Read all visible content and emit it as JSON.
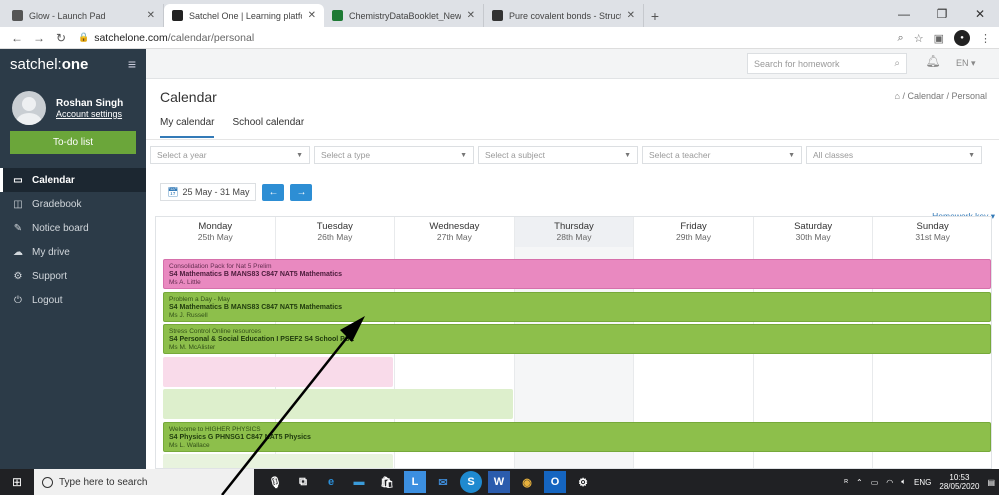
{
  "browser": {
    "tabs": [
      {
        "label": "Glow - Launch Pad",
        "color": "#555555",
        "active": false
      },
      {
        "label": "Satchel One | Learning platform",
        "color": "#222222",
        "active": true
      },
      {
        "label": "ChemistryDataBooklet_NewH_Al",
        "color": "#1e7a34",
        "active": false
      },
      {
        "label": "Pure covalent bonds - Structure",
        "color": "#333333",
        "active": false
      }
    ],
    "new_tab": "+",
    "url_host": "satchelone.com",
    "url_path": "/calendar/personal"
  },
  "app": {
    "brand_prefix": "satchel:",
    "brand_suffix": "one",
    "search_placeholder": "Search for homework",
    "lang": "EN"
  },
  "user": {
    "name": "Roshan Singh",
    "settings": "Account settings"
  },
  "todo_label": "To-do list",
  "menu": [
    {
      "label": "Calendar",
      "icon": "calendar-icon",
      "glyph": "▭",
      "active": true
    },
    {
      "label": "Gradebook",
      "icon": "gradebook-icon",
      "glyph": "◫",
      "active": false
    },
    {
      "label": "Notice board",
      "icon": "pin-icon",
      "glyph": "✎",
      "active": false
    },
    {
      "label": "My drive",
      "icon": "cloud-icon",
      "glyph": "☁",
      "active": false
    },
    {
      "label": "Support",
      "icon": "gear-icon",
      "glyph": "⚙",
      "active": false
    },
    {
      "label": "Logout",
      "icon": "power-icon",
      "glyph": "⏻",
      "active": false
    }
  ],
  "page": {
    "title": "Calendar",
    "breadcrumb": "Calendar / Personal",
    "tabs": [
      "My calendar",
      "School calendar"
    ]
  },
  "filters": [
    {
      "placeholder": "Select a year",
      "width": 160
    },
    {
      "placeholder": "Select a type",
      "width": 160
    },
    {
      "placeholder": "Select a subject",
      "width": 160
    },
    {
      "placeholder": "Select a teacher",
      "width": 160
    },
    {
      "placeholder": "All classes",
      "width": 176
    }
  ],
  "date_range": "25 May - 31 May",
  "homework_key": "Homework key",
  "days": [
    {
      "name": "Monday",
      "date": "25th May",
      "today": false
    },
    {
      "name": "Tuesday",
      "date": "26th May",
      "today": false
    },
    {
      "name": "Wednesday",
      "date": "27th May",
      "today": false
    },
    {
      "name": "Thursday",
      "date": "28th May",
      "today": true
    },
    {
      "name": "Friday",
      "date": "29th May",
      "today": false
    },
    {
      "name": "Saturday",
      "date": "30th May",
      "today": false
    },
    {
      "name": "Sunday",
      "date": "31st May",
      "today": false
    }
  ],
  "events": [
    {
      "title": "Consolidation Pack for Nat 5 Prelim",
      "class": "S4 Mathematics B MANS83 C847 NAT5 Mathematics",
      "teacher": "Ms A. Little",
      "style": "pink",
      "start": 0,
      "span": 7,
      "row": 0
    },
    {
      "title": "Problem a Day - May",
      "class": "S4 Mathematics B MANS83 C847 NAT5 Mathematics",
      "teacher": "Ms J. Russell",
      "style": "green",
      "start": 0,
      "span": 7,
      "row": 1
    },
    {
      "title": "Stress Control Online resources",
      "class": "S4 Personal & Social Education I PSEF2 S4 School PSE",
      "teacher": "Ms M. McAlister",
      "style": "green",
      "start": 0,
      "span": 7,
      "row": 2
    },
    {
      "title": "",
      "class": "",
      "teacher": "",
      "style": "faint-pink",
      "start": 0,
      "span": 2,
      "row": 3
    },
    {
      "title": "",
      "class": "",
      "teacher": "",
      "style": "faint-green",
      "start": 0,
      "span": 3,
      "row": 4
    },
    {
      "title": "Welcome to HIGHER PHYSICS",
      "class": "S4 Physics G PHNSG1 C847 NAT5 Physics",
      "teacher": "Ms L. Wallace",
      "style": "green",
      "start": 0,
      "span": 7,
      "row": 5
    },
    {
      "title": "",
      "class": "",
      "teacher": "",
      "style": "faint-green2",
      "start": 0,
      "span": 2,
      "row": 6
    }
  ],
  "taskbar": {
    "search": "Type here to search",
    "lang": "ENG",
    "time": "10:53",
    "date": "28/05/2020"
  }
}
